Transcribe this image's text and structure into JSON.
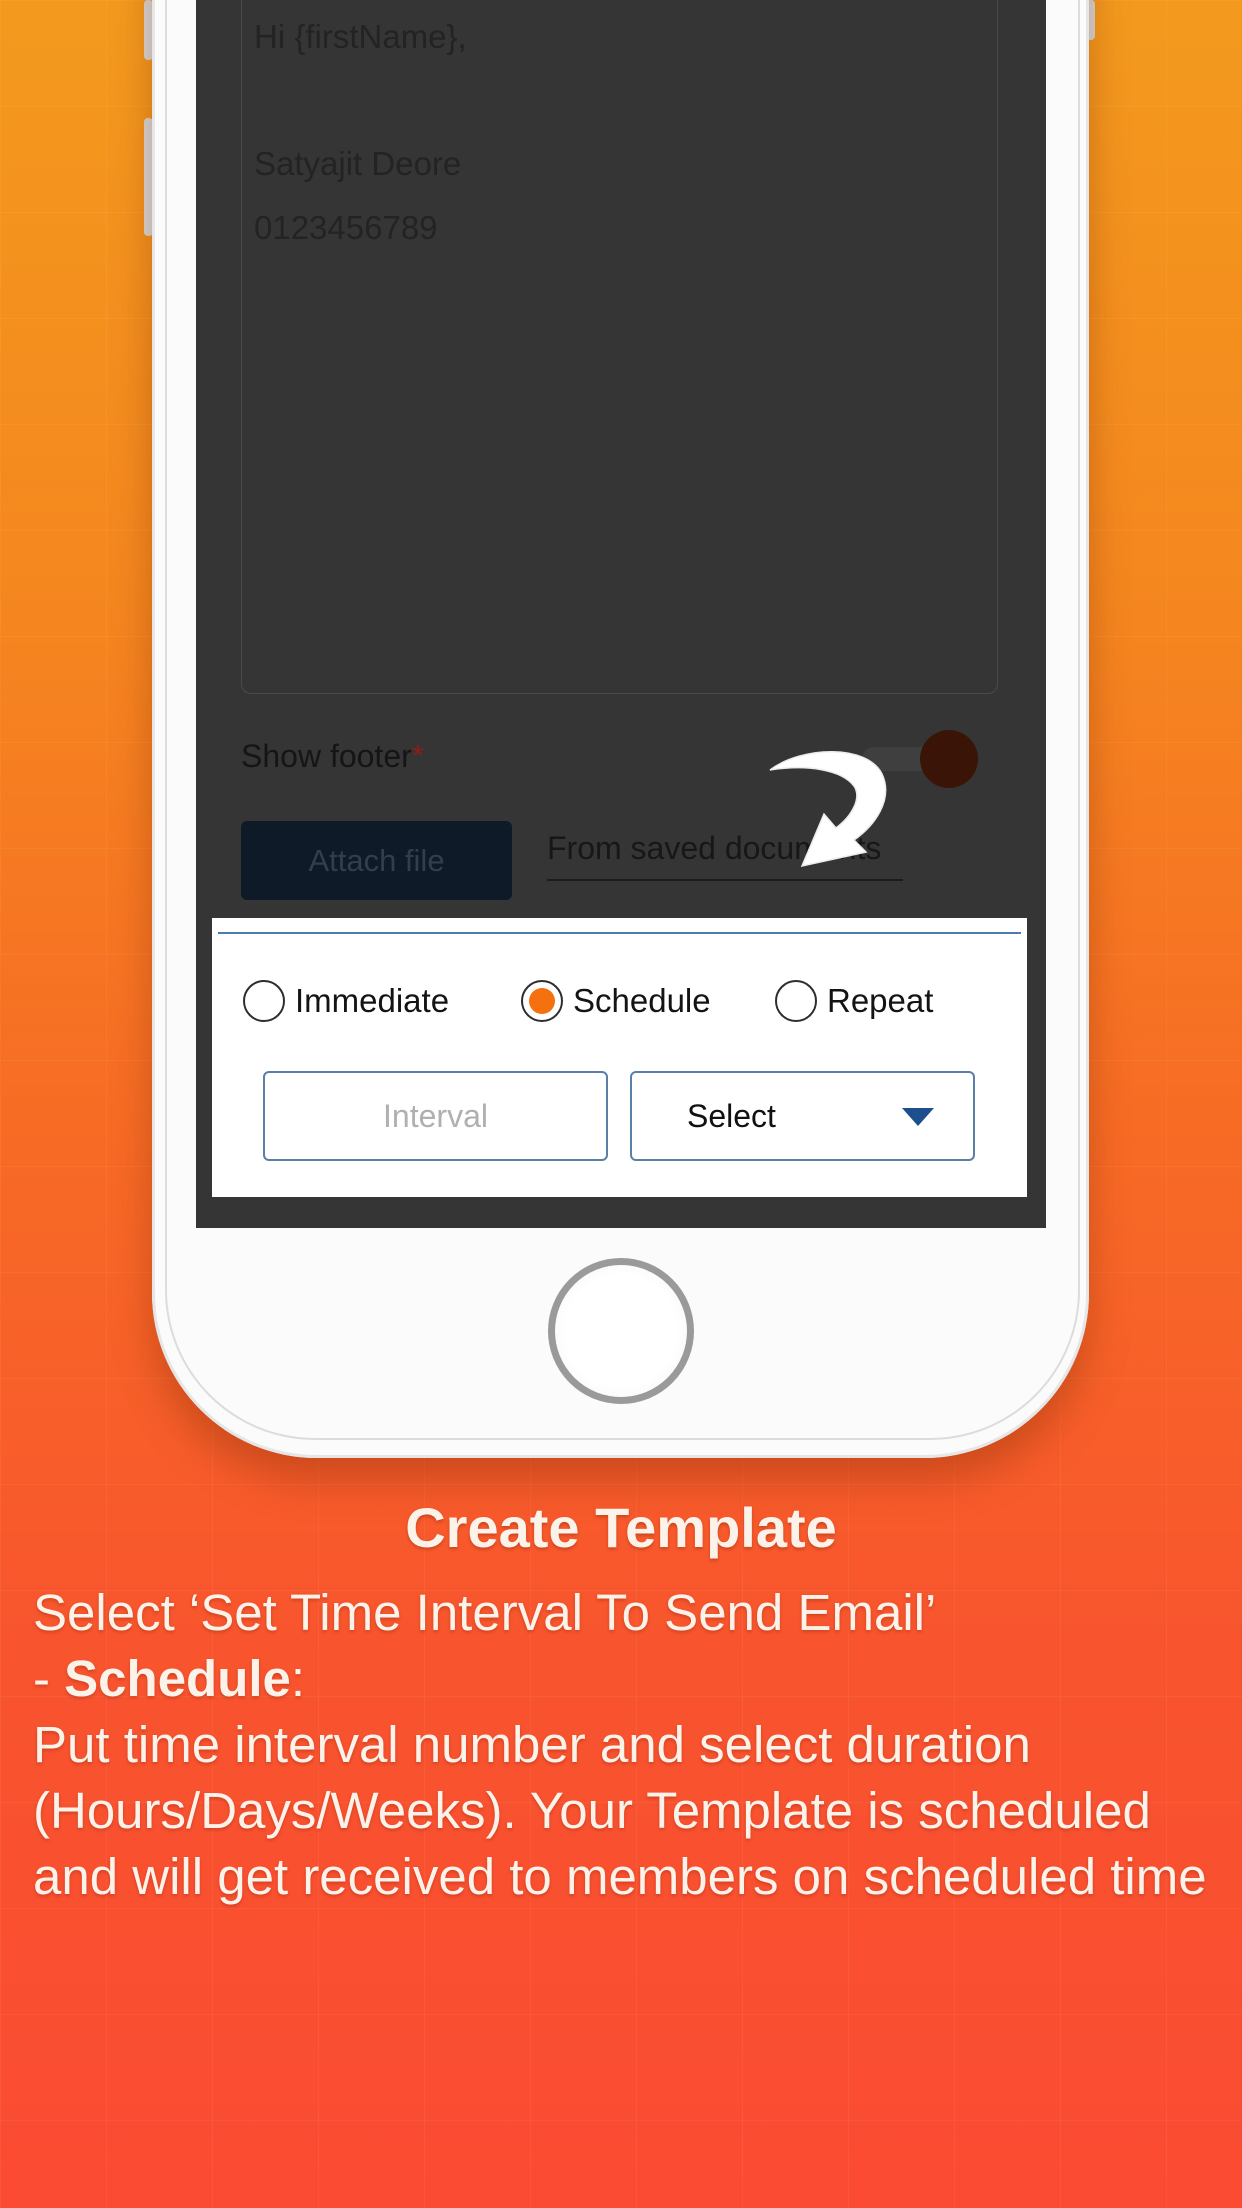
{
  "email_body": {
    "lines": [
      "Hi {firstName},",
      "Satyajit Deore",
      "0123456789"
    ]
  },
  "footer": {
    "label": "Show footer",
    "required_mark": "*",
    "toggle_on": true
  },
  "attach": {
    "button_label": "Attach file",
    "saved_docs_label": "From saved documents"
  },
  "send_options": {
    "radios": [
      {
        "label": "Immediate",
        "checked": false
      },
      {
        "label": "Schedule",
        "checked": true
      },
      {
        "label": "Repeat",
        "checked": false
      }
    ],
    "interval_placeholder": "Interval",
    "select_value": "Select"
  },
  "caption": {
    "title": "Create Template",
    "line1": "Select ‘Set Time Interval To Send Email’",
    "line2_prefix": "- ",
    "line2_bold": "Schedule",
    "line2_suffix": ":",
    "line3": "Put time interval number and select duration (Hours/Days/Weeks). Your Template is scheduled and will get received to members on scheduled time"
  },
  "colors": {
    "accent": "#f5700f",
    "select_caret": "#1d4f8e",
    "background_top": "#f39a1e",
    "background_bottom": "#fb4b33"
  }
}
